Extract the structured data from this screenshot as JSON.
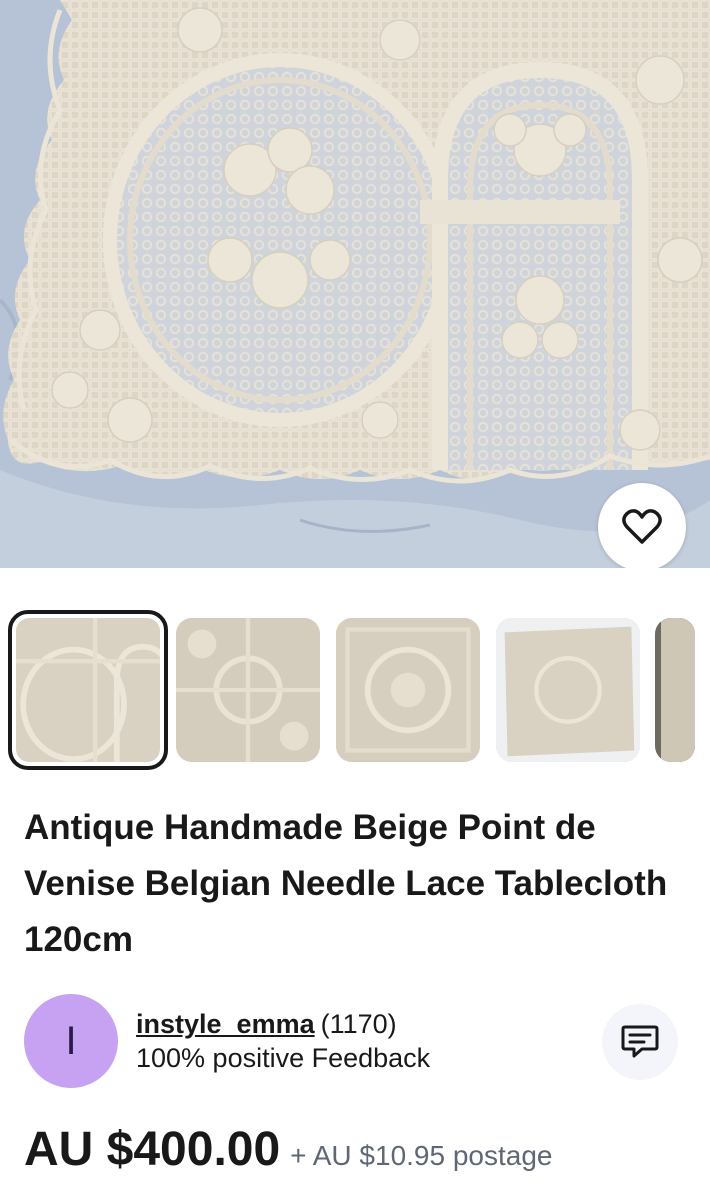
{
  "product": {
    "title": "Antique Handmade Beige Point de Venise Belgian Needle Lace Tablecloth 120cm",
    "image_count_visible": 5,
    "selected_image_index": 0
  },
  "actions": {
    "favorite_icon": "heart-outline-icon",
    "message_icon": "chat-bubble-icon"
  },
  "seller": {
    "avatar_letter": "I",
    "avatar_color": "#c7a1f2",
    "name": "instyle_emma",
    "feedback_count": "(1170)",
    "feedback_text": "100% positive Feedback"
  },
  "pricing": {
    "price": "AU $400.00",
    "postage": "+ AU $10.95 postage"
  },
  "colors": {
    "lace": "#e3dccd",
    "background_cloth": "#b8c4d6",
    "text": "#191919",
    "muted": "#5f6775"
  }
}
